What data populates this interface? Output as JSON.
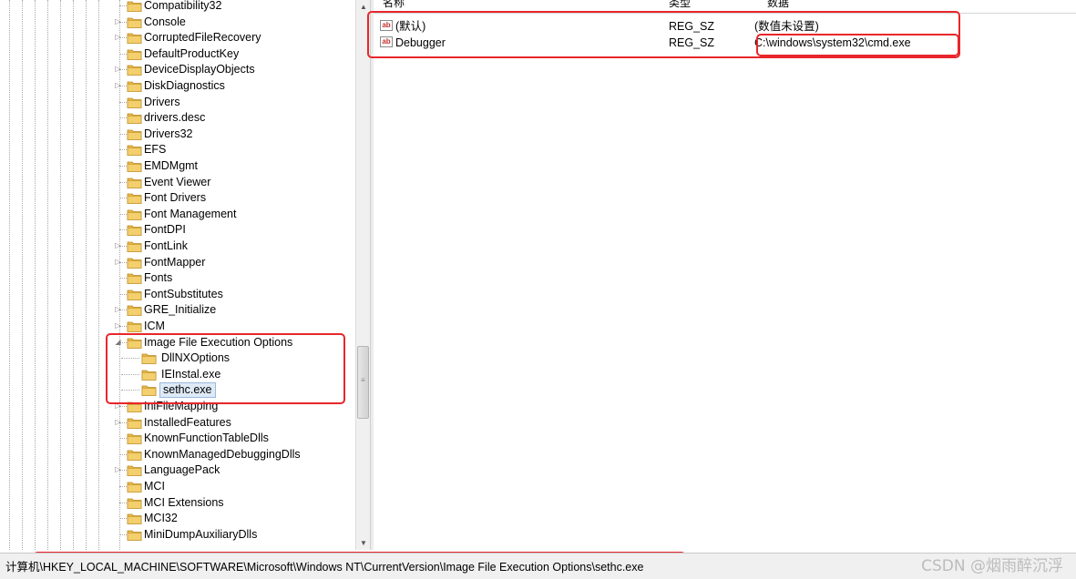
{
  "tree": {
    "items": [
      {
        "label": "Compatibility32",
        "expandable": false
      },
      {
        "label": "Console",
        "expandable": true
      },
      {
        "label": "CorruptedFileRecovery",
        "expandable": true
      },
      {
        "label": "DefaultProductKey",
        "expandable": false
      },
      {
        "label": "DeviceDisplayObjects",
        "expandable": true
      },
      {
        "label": "DiskDiagnostics",
        "expandable": true
      },
      {
        "label": "Drivers",
        "expandable": false
      },
      {
        "label": "drivers.desc",
        "expandable": false
      },
      {
        "label": "Drivers32",
        "expandable": false
      },
      {
        "label": "EFS",
        "expandable": false
      },
      {
        "label": "EMDMgmt",
        "expandable": false
      },
      {
        "label": "Event Viewer",
        "expandable": false
      },
      {
        "label": "Font Drivers",
        "expandable": false
      },
      {
        "label": "Font Management",
        "expandable": false
      },
      {
        "label": "FontDPI",
        "expandable": false
      },
      {
        "label": "FontLink",
        "expandable": true
      },
      {
        "label": "FontMapper",
        "expandable": true
      },
      {
        "label": "Fonts",
        "expandable": false
      },
      {
        "label": "FontSubstitutes",
        "expandable": false
      },
      {
        "label": "GRE_Initialize",
        "expandable": true
      },
      {
        "label": "ICM",
        "expandable": true
      },
      {
        "label": "Image File Execution Options",
        "expandable": true,
        "expanded": true
      },
      {
        "label": "DllNXOptions",
        "child": true
      },
      {
        "label": "IEInstal.exe",
        "child": true
      },
      {
        "label": "sethc.exe",
        "child": true,
        "selected": true
      },
      {
        "label": "IniFileMapping",
        "expandable": true
      },
      {
        "label": "InstalledFeatures",
        "expandable": true
      },
      {
        "label": "KnownFunctionTableDlls",
        "expandable": false
      },
      {
        "label": "KnownManagedDebuggingDlls",
        "expandable": false
      },
      {
        "label": "LanguagePack",
        "expandable": true
      },
      {
        "label": "MCI",
        "expandable": false
      },
      {
        "label": "MCI Extensions",
        "expandable": false
      },
      {
        "label": "MCI32",
        "expandable": false
      },
      {
        "label": "MiniDumpAuxiliaryDlls",
        "expandable": false
      }
    ]
  },
  "values": {
    "columns": {
      "name": "名称",
      "type": "类型",
      "data": "数据"
    },
    "rows": [
      {
        "icon": "string-value-icon",
        "name": "(默认)",
        "type": "REG_SZ",
        "data": "(数值未设置)"
      },
      {
        "icon": "string-value-icon",
        "name": "Debugger",
        "type": "REG_SZ",
        "data": "C:\\windows\\system32\\cmd.exe"
      }
    ]
  },
  "status": {
    "path": "计算机\\HKEY_LOCAL_MACHINE\\SOFTWARE\\Microsoft\\Windows NT\\CurrentVersion\\Image File Execution Options\\sethc.exe"
  },
  "watermark": "CSDN @烟雨醉沉浮",
  "colors": {
    "annotation": "#e8262b",
    "folder": "#e8b84a",
    "selection": "#dfeaf7"
  }
}
